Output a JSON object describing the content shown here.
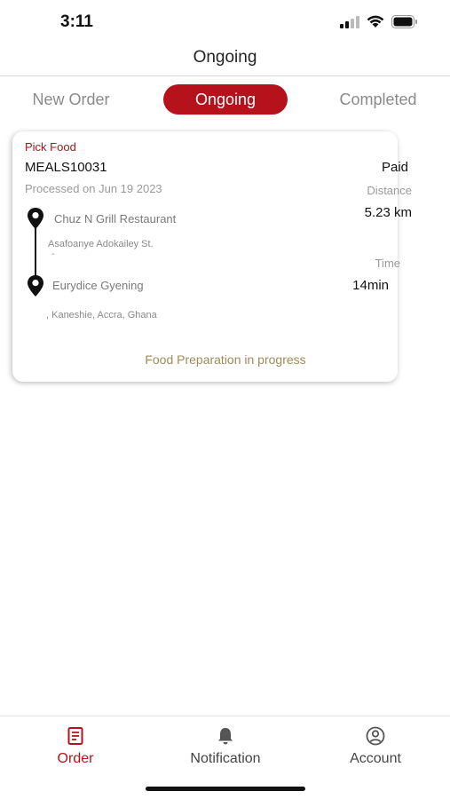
{
  "status_bar": {
    "time": "3:11",
    "icons": [
      "cellular-signal-icon",
      "wifi-icon",
      "battery-icon"
    ]
  },
  "header": {
    "title": "Ongoing"
  },
  "tabs": [
    {
      "label": "New Order",
      "active": false
    },
    {
      "label": "Ongoing",
      "active": true
    },
    {
      "label": "Completed",
      "active": false
    }
  ],
  "order": {
    "type": "Pick Food",
    "id": "MEALS10031",
    "payment_status": "Paid",
    "processed": "Processed on  Jun 19 2023",
    "distance_label": "Distance",
    "distance_value": "5.23 km",
    "time_label": "Time",
    "time_value": "14min",
    "pickup": {
      "name": "Chuz  N  Grill Restaurant",
      "address": "Asafoanye Adokailey St.",
      "address_line2": "-"
    },
    "dropoff": {
      "name": "Eurydice Gyening",
      "address": ", Kaneshie, Accra, Ghana"
    },
    "status": "Food Preparation in progress"
  },
  "bottom_nav": [
    {
      "label": "Order",
      "icon": "receipt-icon",
      "active": true
    },
    {
      "label": "Notification",
      "icon": "bell-icon",
      "active": false
    },
    {
      "label": "Account",
      "icon": "user-circle-icon",
      "active": false
    }
  ],
  "colors": {
    "accent": "#b5121b",
    "status_text": "#a08a5a",
    "muted_text": "#9a9a9a"
  }
}
